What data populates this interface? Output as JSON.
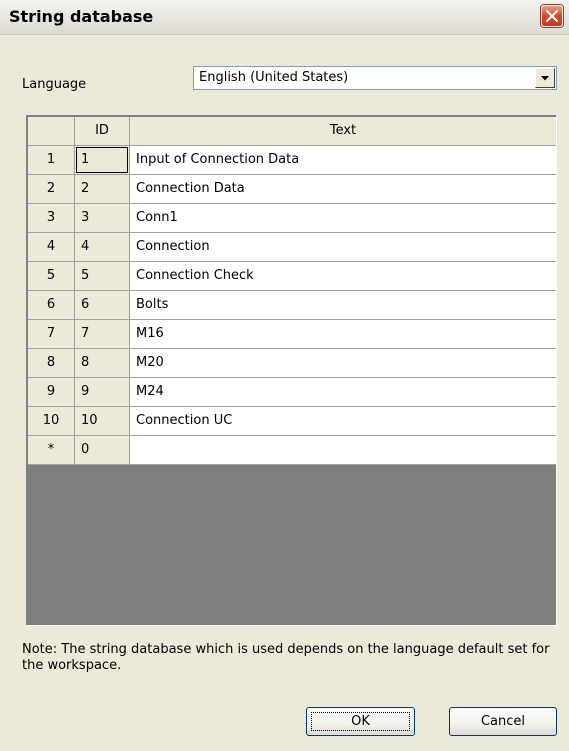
{
  "window": {
    "title": "String database",
    "close_icon": "close-icon"
  },
  "language": {
    "label": "Language",
    "selected": "English (United States)",
    "dropdown_icon": "chevron-down-icon"
  },
  "grid": {
    "columns": {
      "row_header": "",
      "id": "ID",
      "text": "Text"
    },
    "rows": [
      {
        "num": "1",
        "id": "1",
        "text": "Input of Connection Data"
      },
      {
        "num": "2",
        "id": "2",
        "text": "Connection Data"
      },
      {
        "num": "3",
        "id": "3",
        "text": "Conn1"
      },
      {
        "num": "4",
        "id": "4",
        "text": "Connection"
      },
      {
        "num": "5",
        "id": "5",
        "text": "Connection Check"
      },
      {
        "num": "6",
        "id": "6",
        "text": "Bolts"
      },
      {
        "num": "7",
        "id": "7",
        "text": "M16"
      },
      {
        "num": "8",
        "id": "8",
        "text": "M20"
      },
      {
        "num": "9",
        "id": "9",
        "text": "M24"
      },
      {
        "num": "10",
        "id": "10",
        "text": "Connection UC"
      }
    ],
    "new_row": {
      "num": "*",
      "id": "0",
      "text": ""
    }
  },
  "note": "Note: The string database which is used depends on the language default set for the workspace.",
  "buttons": {
    "ok": "OK",
    "cancel": "Cancel"
  },
  "colors": {
    "titlebar": "#dcdad0",
    "close_button": "#d5492a",
    "dialog_bg": "#ece9d8",
    "empty_grid_bg": "#7f7f7f"
  }
}
